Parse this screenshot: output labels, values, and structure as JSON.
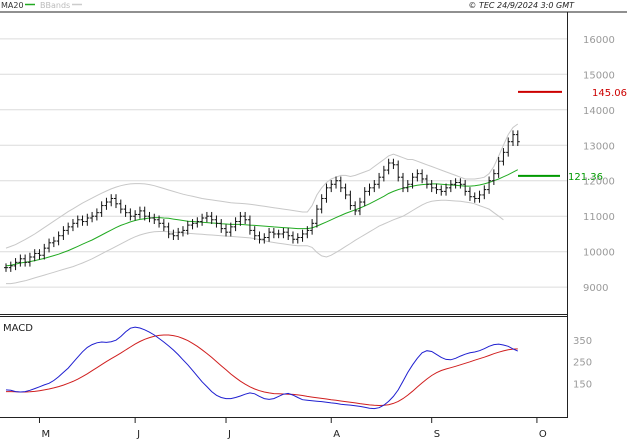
{
  "header": {
    "ma_label": "MA20",
    "bands_label": "BBands",
    "copyright": "© TEC 24/9/2024 3:0 GMT"
  },
  "colors": {
    "ma": "#22aa22",
    "macd": "#1f1fd0",
    "signal": "#d01f1f",
    "bands": "#c8c8c8",
    "ohlc": "#111111",
    "resistance": "#cc0000",
    "support": "#009900"
  },
  "chart_data": [
    {
      "type": "line",
      "name": "price",
      "ylim": [
        8300,
        16700
      ],
      "yticks": [
        16000,
        15000,
        14000,
        13000,
        12000,
        11000,
        10000,
        9000
      ],
      "x_range": [
        0,
        106
      ],
      "months": [
        {
          "label": "M",
          "x": 7
        },
        {
          "label": "J",
          "x": 27
        },
        {
          "label": "J",
          "x": 46
        },
        {
          "label": "A",
          "x": 68
        },
        {
          "label": "S",
          "x": 89
        },
        {
          "label": "O",
          "x": 111
        }
      ],
      "close": [
        9550,
        9600,
        9700,
        9800,
        9700,
        9850,
        9950,
        9900,
        10100,
        10250,
        10300,
        10450,
        10600,
        10700,
        10800,
        10900,
        10850,
        10950,
        11000,
        11100,
        11300,
        11400,
        11500,
        11350,
        11200,
        11100,
        11000,
        11050,
        11150,
        11000,
        10950,
        10900,
        10800,
        10700,
        10500,
        10450,
        10550,
        10600,
        10750,
        10800,
        10850,
        10950,
        11000,
        10900,
        10800,
        10650,
        10550,
        10700,
        10850,
        11000,
        10900,
        10600,
        10450,
        10350,
        10400,
        10550,
        10500,
        10500,
        10550,
        10450,
        10350,
        10400,
        10500,
        10600,
        10800,
        11200,
        11500,
        11800,
        11900,
        12000,
        11800,
        11600,
        11300,
        11150,
        11400,
        11700,
        11800,
        11900,
        12100,
        12300,
        12500,
        12450,
        12100,
        11800,
        11900,
        12100,
        12200,
        12050,
        11900,
        11800,
        11750,
        11700,
        11800,
        11900,
        11950,
        11900,
        11700,
        11550,
        11500,
        11600,
        11750,
        12000,
        12200,
        12550,
        12800,
        13100,
        13300,
        13100
      ],
      "ma20": [
        9600,
        9620,
        9650,
        9680,
        9700,
        9720,
        9750,
        9780,
        9810,
        9850,
        9890,
        9930,
        9980,
        10030,
        10090,
        10150,
        10210,
        10270,
        10330,
        10400,
        10470,
        10540,
        10610,
        10680,
        10740,
        10790,
        10840,
        10880,
        10910,
        10930,
        10950,
        10960,
        10960,
        10950,
        10940,
        10920,
        10900,
        10880,
        10860,
        10850,
        10840,
        10830,
        10820,
        10810,
        10800,
        10790,
        10780,
        10770,
        10770,
        10770,
        10760,
        10750,
        10740,
        10730,
        10720,
        10710,
        10700,
        10690,
        10680,
        10670,
        10660,
        10650,
        10650,
        10650,
        10670,
        10720,
        10780,
        10840,
        10900,
        10960,
        11020,
        11080,
        11130,
        11180,
        11230,
        11290,
        11350,
        11420,
        11490,
        11560,
        11640,
        11700,
        11750,
        11790,
        11820,
        11850,
        11870,
        11890,
        11900,
        11910,
        11910,
        11900,
        11890,
        11880,
        11870,
        11860,
        11850,
        11850,
        11860,
        11880,
        11910,
        11950,
        12000,
        12050,
        12110,
        12170,
        12240,
        12310
      ],
      "upper_band": [
        10100,
        10150,
        10200,
        10270,
        10340,
        10420,
        10500,
        10590,
        10680,
        10770,
        10860,
        10950,
        11040,
        11130,
        11210,
        11290,
        11370,
        11440,
        11510,
        11580,
        11650,
        11710,
        11770,
        11820,
        11860,
        11890,
        11910,
        11920,
        11920,
        11910,
        11890,
        11860,
        11820,
        11780,
        11740,
        11700,
        11660,
        11620,
        11590,
        11560,
        11530,
        11500,
        11480,
        11460,
        11440,
        11420,
        11400,
        11380,
        11370,
        11360,
        11350,
        11340,
        11320,
        11300,
        11280,
        11260,
        11240,
        11220,
        11200,
        11180,
        11160,
        11140,
        11120,
        11120,
        11300,
        11600,
        11800,
        11950,
        12050,
        12100,
        12150,
        12150,
        12120,
        12150,
        12200,
        12250,
        12300,
        12400,
        12500,
        12600,
        12700,
        12750,
        12700,
        12650,
        12600,
        12600,
        12550,
        12500,
        12450,
        12400,
        12350,
        12300,
        12250,
        12200,
        12150,
        12100,
        12050,
        12050,
        12050,
        12070,
        12100,
        12200,
        12400,
        12700,
        13000,
        13300,
        13500,
        13600
      ],
      "lower_band": [
        9100,
        9100,
        9120,
        9150,
        9180,
        9220,
        9260,
        9300,
        9340,
        9380,
        9420,
        9460,
        9500,
        9540,
        9580,
        9630,
        9680,
        9740,
        9800,
        9870,
        9940,
        10010,
        10080,
        10150,
        10220,
        10290,
        10360,
        10420,
        10470,
        10510,
        10540,
        10560,
        10570,
        10570,
        10560,
        10550,
        10540,
        10530,
        10520,
        10510,
        10500,
        10490,
        10480,
        10470,
        10460,
        10450,
        10440,
        10430,
        10420,
        10410,
        10400,
        10390,
        10370,
        10340,
        10310,
        10280,
        10260,
        10240,
        10220,
        10200,
        10180,
        10170,
        10170,
        10170,
        10120,
        9980,
        9880,
        9850,
        9900,
        9980,
        10060,
        10150,
        10230,
        10320,
        10400,
        10480,
        10560,
        10640,
        10720,
        10780,
        10840,
        10900,
        10950,
        11000,
        11080,
        11160,
        11240,
        11320,
        11380,
        11420,
        11440,
        11450,
        11450,
        11440,
        11430,
        11420,
        11400,
        11380,
        11350,
        11300,
        11250,
        11200,
        11100,
        11000,
        10900
      ]
    },
    {
      "type": "line",
      "name": "MACD",
      "title": "MACD",
      "ylim": [
        0,
        450
      ],
      "yticks": [
        350,
        250,
        150
      ],
      "macd": [
        120,
        118,
        112,
        110,
        112,
        118,
        126,
        134,
        143,
        150,
        163,
        180,
        200,
        220,
        245,
        270,
        295,
        315,
        328,
        336,
        340,
        338,
        341,
        348,
        365,
        386,
        403,
        408,
        404,
        396,
        385,
        372,
        356,
        340,
        322,
        303,
        282,
        258,
        235,
        210,
        183,
        157,
        135,
        112,
        95,
        85,
        80,
        80,
        85,
        92,
        100,
        106,
        102,
        90,
        80,
        76,
        80,
        90,
        100,
        104,
        96,
        85,
        75,
        72,
        70,
        68,
        66,
        63,
        60,
        58,
        54,
        52,
        50,
        47,
        44,
        40,
        36,
        34,
        38,
        50,
        67,
        90,
        120,
        160,
        200,
        235,
        265,
        290,
        300,
        296,
        283,
        269,
        260,
        258,
        265,
        275,
        284,
        290,
        294,
        300,
        309,
        320,
        328,
        330,
        326,
        320,
        308,
        298
      ],
      "signal": [
        112,
        112,
        111,
        110,
        110,
        111,
        113,
        116,
        120,
        124,
        129,
        135,
        142,
        150,
        159,
        169,
        181,
        194,
        208,
        222,
        236,
        250,
        263,
        276,
        289,
        303,
        317,
        330,
        342,
        352,
        360,
        366,
        370,
        372,
        372,
        369,
        364,
        356,
        346,
        334,
        320,
        304,
        287,
        269,
        250,
        231,
        212,
        193,
        176,
        160,
        146,
        134,
        124,
        116,
        110,
        106,
        103,
        102,
        101,
        100,
        99,
        97,
        94,
        90,
        87,
        84,
        81,
        78,
        75,
        72,
        69,
        66,
        63,
        60,
        57,
        54,
        51,
        49,
        48,
        49,
        52,
        58,
        67,
        80,
        96,
        114,
        133,
        152,
        170,
        186,
        199,
        209,
        216,
        222,
        228,
        235,
        242,
        249,
        256,
        263,
        270,
        278,
        286,
        293,
        299,
        304,
        307,
        308
      ]
    }
  ],
  "levels": {
    "resistance_label": "145.06",
    "resistance_value": 14506,
    "support_label": "121.36",
    "support_value": 12136
  }
}
